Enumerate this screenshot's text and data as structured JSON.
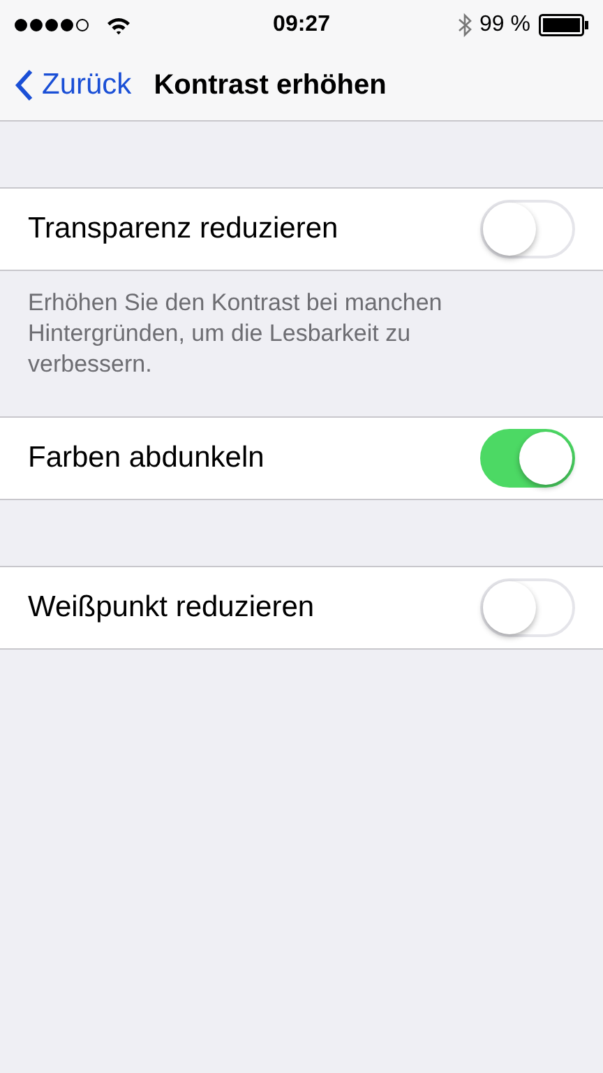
{
  "status_bar": {
    "time": "09:27",
    "battery": "99 %"
  },
  "nav_bar": {
    "back": "Zurück",
    "title": "Kontrast erhöhen"
  },
  "sections": [
    {
      "rows": [
        {
          "label": "Transparenz reduzieren",
          "on": false
        }
      ],
      "footer": "Erhöhen Sie den Kontrast bei manchen Hintergründen, um die Lesbarkeit zu verbessern."
    },
    {
      "rows": [
        {
          "label": "Farben abdunkeln",
          "on": true
        }
      ]
    },
    {
      "rows": [
        {
          "label": "Weißpunkt reduzieren",
          "on": false
        }
      ]
    }
  ]
}
